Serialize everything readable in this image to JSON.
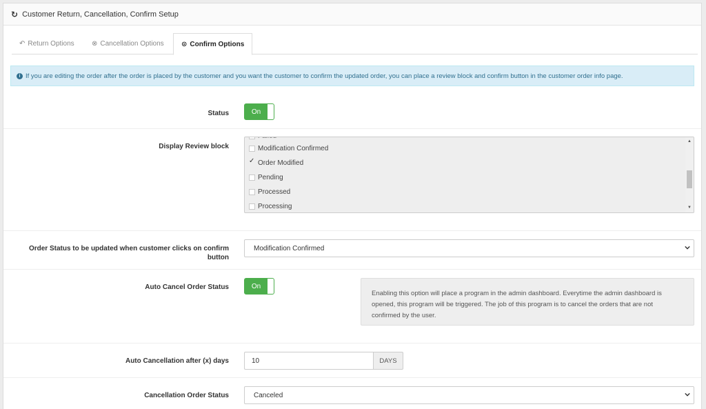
{
  "panel": {
    "title": "Customer Return, Cancellation, Confirm Setup",
    "title_icon": "refresh-icon"
  },
  "tabs": [
    {
      "label": "Return Options",
      "icon": "reply-icon",
      "active": false
    },
    {
      "label": "Cancellation Options",
      "icon": "times-circle-icon",
      "active": false
    },
    {
      "label": "Confirm Options",
      "icon": "check-circle-icon",
      "active": true
    }
  ],
  "alert": {
    "icon": "info-circle-icon",
    "text": "If you are editing the order after the order is placed by the customer and you want the customer to confirm the updated order, you can place a review block and confirm button in the customer order info page."
  },
  "status": {
    "label": "Status",
    "toggle_label": "On",
    "value": true
  },
  "review_block": {
    "label": "Display Review block",
    "items": [
      {
        "label": "Modification Confirmed",
        "checked": false
      },
      {
        "label": "Order Modified",
        "checked": true
      },
      {
        "label": "Pending",
        "checked": false
      },
      {
        "label": "Processed",
        "checked": false
      },
      {
        "label": "Processing",
        "checked": false
      }
    ]
  },
  "confirm_status": {
    "label_line1": "Order Status to be updated when customer clicks on confirm",
    "label_line2": "button",
    "selected": "Modification Confirmed"
  },
  "auto_cancel": {
    "label": "Auto Cancel Order Status",
    "toggle_label": "On",
    "value": true,
    "note": "Enabling this option will place a program in the admin dashboard. Everytime the admin dashboard is opened, this program will be triggered. The job of this program is to cancel the orders that are not confirmed by the user."
  },
  "auto_cancel_days": {
    "label": "Auto Cancellation after (x) days",
    "value": "10",
    "addon": "DAYS"
  },
  "cancellation_status": {
    "label": "Cancellation Order Status",
    "selected": "Canceled"
  },
  "colors": {
    "accent_green": "#4cae4c",
    "info_bg": "#d9edf7",
    "info_text": "#31708f"
  }
}
